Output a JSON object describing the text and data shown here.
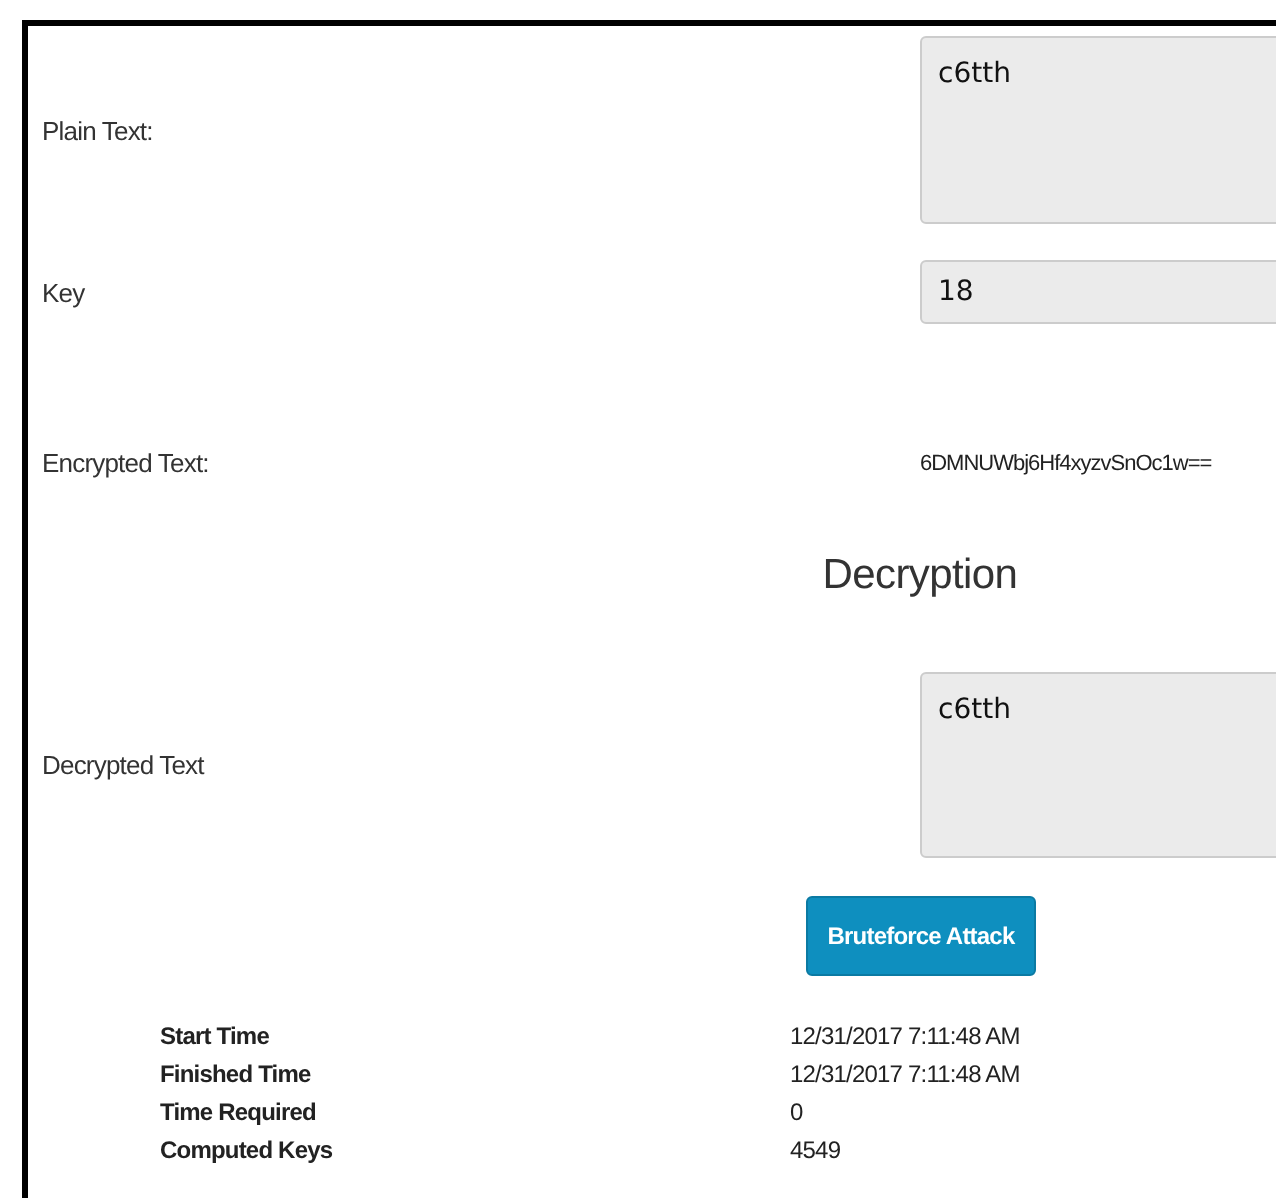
{
  "fields": [
    {
      "label": "Plain Text:",
      "kind": "textarea",
      "value": "c6tth"
    },
    {
      "label": "Key",
      "kind": "input",
      "value": "18"
    },
    {
      "label": "Encrypted Text:",
      "kind": "output",
      "value": "6DMNUWbj6Hf4xyzvSnOc1w=="
    }
  ],
  "decryption": {
    "heading": "Decryption",
    "field": {
      "label": "Decrypted Text",
      "kind": "textarea",
      "value": "c6tth"
    },
    "button": "Bruteforce Attack"
  },
  "stats": [
    {
      "label": "Start Time",
      "value": "12/31/2017 7:11:48 AM"
    },
    {
      "label": "Finished Time",
      "value": "12/31/2017 7:11:48 AM"
    },
    {
      "label": "Time Required",
      "value": "0"
    },
    {
      "label": "Computed Keys",
      "value": "4549"
    }
  ]
}
